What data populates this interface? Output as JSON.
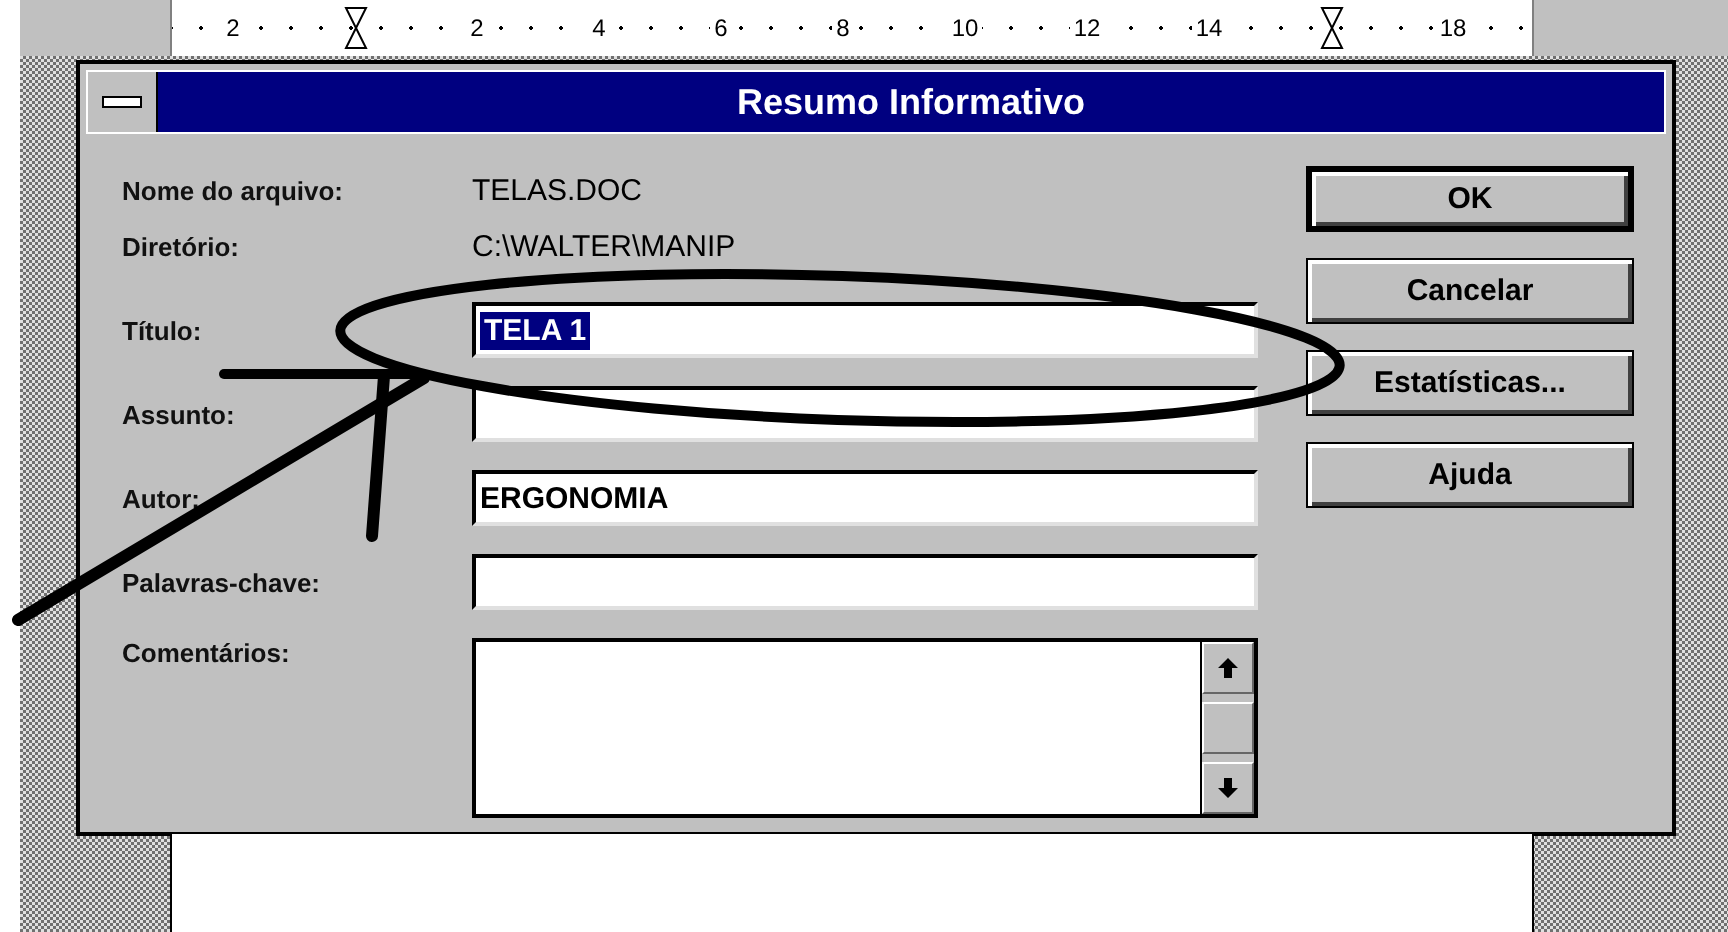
{
  "ruler": {
    "items": [
      {
        "kind": "number",
        "text": "2"
      },
      {
        "kind": "indent-marker"
      },
      {
        "kind": "number",
        "text": "2"
      },
      {
        "kind": "number",
        "text": "4"
      },
      {
        "kind": "number",
        "text": "6"
      },
      {
        "kind": "number",
        "text": "8"
      },
      {
        "kind": "number",
        "text": "10"
      },
      {
        "kind": "number",
        "text": "12"
      },
      {
        "kind": "number",
        "text": "14"
      },
      {
        "kind": "indent-marker"
      },
      {
        "kind": "number",
        "text": "18"
      }
    ]
  },
  "dialog": {
    "title": "Resumo Informativo",
    "info": [
      {
        "label": "Nome do arquivo:",
        "value": "TELAS.DOC"
      },
      {
        "label": "Diretório:",
        "value": "C:\\WALTER\\MANIP"
      }
    ],
    "fields": [
      {
        "label": "Título:",
        "value": "TELA 1",
        "selected": true,
        "kind": "line"
      },
      {
        "label": "Assunto:",
        "kind": "line"
      },
      {
        "label": "Autor:",
        "value": "ERGONOMIA",
        "selected": false,
        "kind": "line"
      },
      {
        "label": "Palavras-chave:",
        "kind": "line"
      },
      {
        "label": "Comentários:",
        "kind": "memo"
      }
    ],
    "buttons": [
      {
        "label": "OK",
        "default": true
      },
      {
        "label": "Cancelar",
        "default": false
      },
      {
        "label": "Estatísticas...",
        "default": false
      },
      {
        "label": "Ajuda",
        "default": false
      }
    ]
  }
}
